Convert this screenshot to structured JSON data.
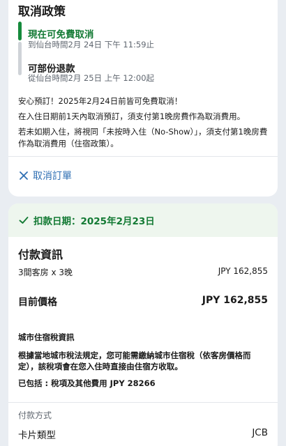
{
  "cancellation": {
    "title": "取消政策",
    "free": {
      "title": "現在可免費取消",
      "until": "到仙台時間2月 24日 下午 11:59止"
    },
    "partial": {
      "title": "可部份退款",
      "from": "從仙台時間2月 25日 上午 12:00起"
    },
    "notices": [
      "安心預訂！2025年2月24日前皆可免費取消！",
      "在入住日期前1天內取消預訂，須支付第1晚房費作為取消費用。",
      "若未如期入住，將視同「未按時入住（No-Show）」，須支付第1晚房費作為取消費用（住宿政策）。"
    ],
    "cancel_label": "取消訂單",
    "colors": {
      "free": "#137a34",
      "link": "#2f6fb3"
    }
  },
  "payment": {
    "charge_date_label": "扣款日期：2025年2月23日",
    "title": "付款資訊",
    "rooms_label": "3間客房 x 3晚",
    "rooms_price": "JPY 162,855",
    "total_label": "目前價格",
    "total_price": "JPY 162,855",
    "tax_title": "城市住宿稅資訊",
    "tax_desc": "根據當地城市稅法規定，您可能需繳納城市住宿稅（依客房價格而定），該稅項會在您入住時直接由住宿方收取。",
    "tax_included": "已包括 : 稅項及其他費用 JPY 28266",
    "method_title": "付款方式",
    "card_type_label": "卡片類型",
    "card_type_value": "JCB"
  }
}
